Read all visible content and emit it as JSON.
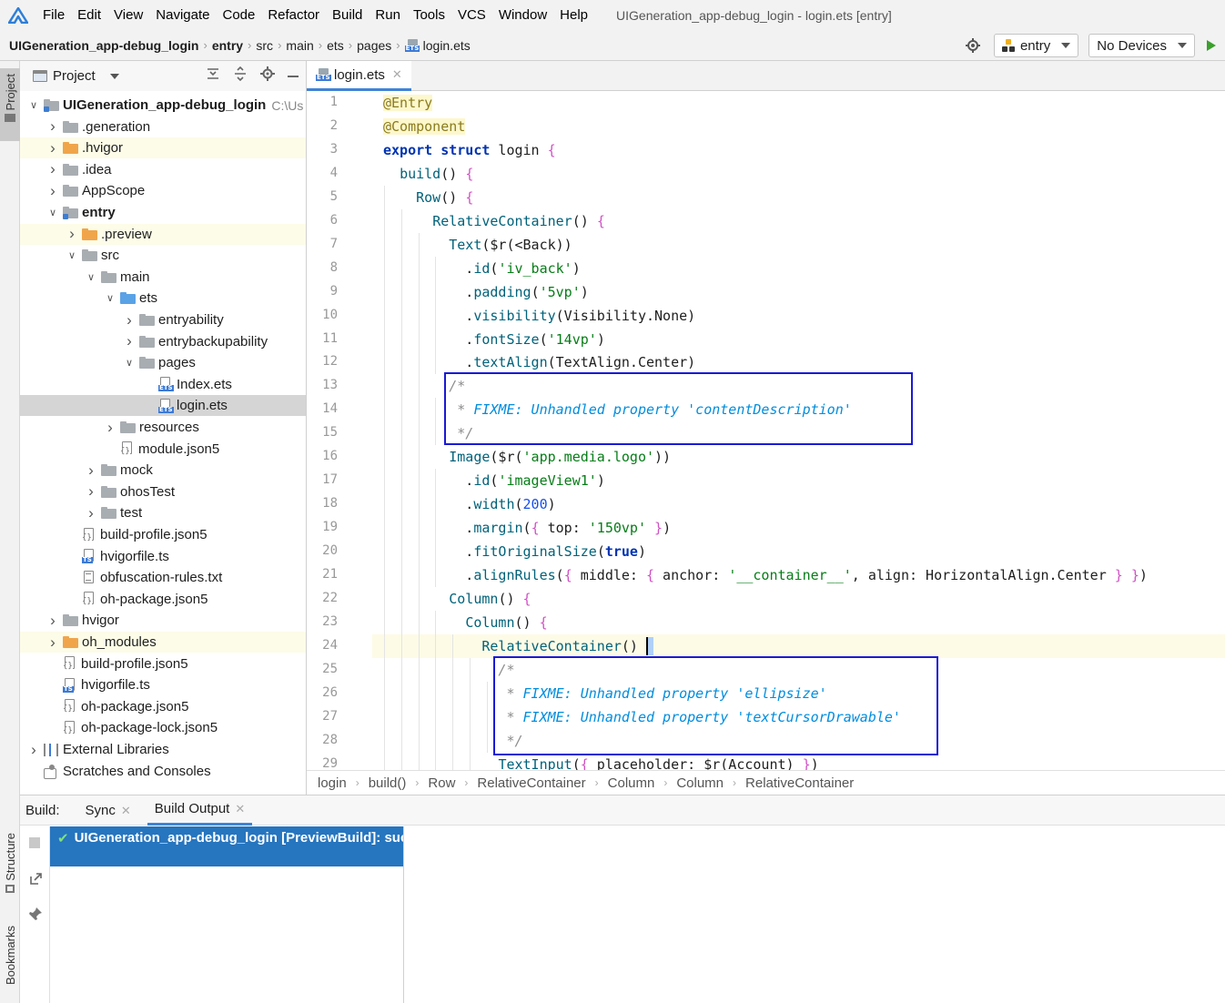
{
  "menu": {
    "items": [
      "File",
      "Edit",
      "View",
      "Navigate",
      "Code",
      "Refactor",
      "Build",
      "Run",
      "Tools",
      "VCS",
      "Window",
      "Help"
    ],
    "window_title": "UIGeneration_app-debug_login - login.ets [entry]"
  },
  "nav": {
    "crumbs": [
      "UIGeneration_app-debug_login",
      "entry",
      "src",
      "main",
      "ets",
      "pages",
      "login.ets"
    ],
    "run_config": "entry",
    "device": "No Devices"
  },
  "left_stripe": {
    "project": "Project",
    "structure": "Structure",
    "bookmarks": "Bookmarks"
  },
  "project_panel": {
    "title": "Project",
    "tree": [
      {
        "label": "UIGeneration_app-debug_login",
        "suffix": "C:\\Us",
        "depth": 0,
        "expanded": true,
        "icon": "module-folder",
        "bold": true
      },
      {
        "label": ".generation",
        "depth": 1,
        "expanded": false,
        "icon": "gray-folder"
      },
      {
        "label": ".hvigor",
        "depth": 1,
        "expanded": false,
        "icon": "orange-folder",
        "hl": true
      },
      {
        "label": ".idea",
        "depth": 1,
        "expanded": false,
        "icon": "gray-folder"
      },
      {
        "label": "AppScope",
        "depth": 1,
        "expanded": false,
        "icon": "gray-folder"
      },
      {
        "label": "entry",
        "depth": 1,
        "expanded": true,
        "icon": "module-folder",
        "bold": true
      },
      {
        "label": ".preview",
        "depth": 2,
        "expanded": false,
        "icon": "orange-folder",
        "hl": true
      },
      {
        "label": "src",
        "depth": 2,
        "expanded": true,
        "icon": "gray-folder"
      },
      {
        "label": "main",
        "depth": 3,
        "expanded": true,
        "icon": "gray-folder"
      },
      {
        "label": "ets",
        "depth": 4,
        "expanded": true,
        "icon": "blue-folder"
      },
      {
        "label": "entryability",
        "depth": 5,
        "expanded": false,
        "icon": "gray-folder"
      },
      {
        "label": "entrybackupability",
        "depth": 5,
        "expanded": false,
        "icon": "gray-folder"
      },
      {
        "label": "pages",
        "depth": 5,
        "expanded": true,
        "icon": "gray-folder"
      },
      {
        "label": "Index.ets",
        "depth": 6,
        "leaf": true,
        "icon": "ets-file"
      },
      {
        "label": "login.ets",
        "depth": 6,
        "leaf": true,
        "icon": "ets-file",
        "selected": true
      },
      {
        "label": "resources",
        "depth": 4,
        "expanded": false,
        "icon": "gray-folder"
      },
      {
        "label": "module.json5",
        "depth": 4,
        "leaf": true,
        "icon": "json-file"
      },
      {
        "label": "mock",
        "depth": 3,
        "expanded": false,
        "icon": "gray-folder"
      },
      {
        "label": "ohosTest",
        "depth": 3,
        "expanded": false,
        "icon": "gray-folder"
      },
      {
        "label": "test",
        "depth": 3,
        "expanded": false,
        "icon": "gray-folder"
      },
      {
        "label": "build-profile.json5",
        "depth": 2,
        "leaf": true,
        "icon": "json-file"
      },
      {
        "label": "hvigorfile.ts",
        "depth": 2,
        "leaf": true,
        "icon": "ts-file"
      },
      {
        "label": "obfuscation-rules.txt",
        "depth": 2,
        "leaf": true,
        "icon": "txt-file"
      },
      {
        "label": "oh-package.json5",
        "depth": 2,
        "leaf": true,
        "icon": "json-file"
      },
      {
        "label": "hvigor",
        "depth": 1,
        "expanded": false,
        "icon": "gray-folder"
      },
      {
        "label": "oh_modules",
        "depth": 1,
        "expanded": false,
        "icon": "orange-folder",
        "hl": true
      },
      {
        "label": "build-profile.json5",
        "depth": 1,
        "leaf": true,
        "icon": "json-file"
      },
      {
        "label": "hvigorfile.ts",
        "depth": 1,
        "leaf": true,
        "icon": "ts-file"
      },
      {
        "label": "oh-package.json5",
        "depth": 1,
        "leaf": true,
        "icon": "json-file"
      },
      {
        "label": "oh-package-lock.json5",
        "depth": 1,
        "leaf": true,
        "icon": "json-file"
      },
      {
        "label": "External Libraries",
        "depth": 0,
        "expanded": false,
        "icon": "library"
      },
      {
        "label": "Scratches and Consoles",
        "depth": 0,
        "leaf": true,
        "icon": "scratch"
      }
    ]
  },
  "editor": {
    "tab": "login.ets",
    "lines": [
      "@Entry",
      "@Component",
      "export struct login {",
      "  build() {",
      "    Row() {",
      "      RelativeContainer() {",
      "        Text($r(<Back))",
      "          .id('iv_back')",
      "          .padding('5vp')",
      "          .visibility(Visibility.None)",
      "          .fontSize('14vp')",
      "          .textAlign(TextAlign.Center)",
      "        /*",
      "         * FIXME: Unhandled property 'contentDescription'",
      "         */",
      "        Image($r('app.media.logo'))",
      "          .id('imageView1')",
      "          .width(200)",
      "          .margin({ top: '150vp' })",
      "          .fitOriginalSize(true)",
      "          .alignRules({ middle: { anchor: '__container__', align: HorizontalAlign.Center } })",
      "        Column() {",
      "          Column() {",
      "            RelativeContainer() ",
      "              /*",
      "               * FIXME: Unhandled property 'ellipsize'",
      "               * FIXME: Unhandled property 'textCursorDrawable'",
      "               */",
      "              TextInput({ placeholder: $r(Account) })"
    ],
    "breadcrumb": [
      "login",
      "build()",
      "Row",
      "RelativeContainer",
      "Column",
      "Column",
      "RelativeContainer"
    ]
  },
  "build_panel": {
    "label": "Build:",
    "tabs": [
      "Sync",
      "Build Output"
    ],
    "active_tab": "Build Output",
    "result": "UIGeneration_app-debug_login [PreviewBuild]: suc"
  },
  "colors": {
    "accent": "#4083d6",
    "highlight_box": "#1a1ad6",
    "build_row": "#2675bf"
  }
}
